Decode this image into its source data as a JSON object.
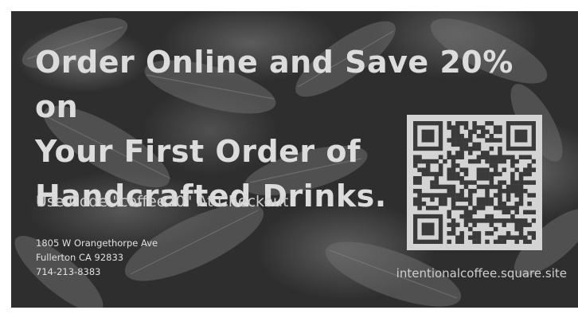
{
  "headline": {
    "line1": "Order Online and Save 20% on",
    "line2": "Your First Order of",
    "line3": "Handcrafted Drinks."
  },
  "promo_text": "Use Code \"coffee20\" At Checkout",
  "address": {
    "street": "1805 W Orangethorpe Ave",
    "city": "Fullerton CA 92833",
    "phone": "714-213-8383"
  },
  "website": "intentionalcoffee.square.site",
  "qr_code_icon": "qr-code-icon",
  "colors": {
    "background": "#2e2e2e",
    "text": "#dcdcdc",
    "qr_background": "#d4d4d4",
    "qr_modules": "#3a3a3a"
  }
}
